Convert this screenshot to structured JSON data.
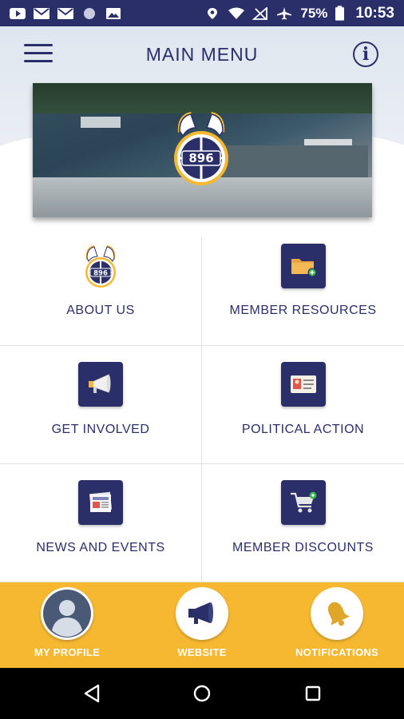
{
  "status_bar": {
    "battery": "75%",
    "time": "10:53",
    "icons": [
      "youtube-icon",
      "gmail-icon",
      "gmail-icon",
      "circle-icon",
      "image-icon",
      "location-icon",
      "wifi-icon",
      "no-signal-icon",
      "airplane-icon",
      "battery-icon"
    ]
  },
  "header": {
    "title": "MAIN MENU",
    "menu_icon": "hamburger-menu-icon",
    "info_icon": "info-icon",
    "info_glyph": "i",
    "logo_number": "896"
  },
  "menu": {
    "items": [
      {
        "label": "ABOUT US",
        "icon": "teamsters-logo-icon"
      },
      {
        "label": "MEMBER RESOURCES",
        "icon": "folder-icon"
      },
      {
        "label": "GET INVOLVED",
        "icon": "megaphone-icon"
      },
      {
        "label": "POLITICAL ACTION",
        "icon": "id-card-icon"
      },
      {
        "label": "NEWS AND EVENTS",
        "icon": "newspaper-icon"
      },
      {
        "label": "MEMBER DISCOUNTS",
        "icon": "shopping-cart-icon"
      }
    ]
  },
  "bottom_bar": {
    "items": [
      {
        "label": "MY PROFILE",
        "icon": "profile-avatar-icon"
      },
      {
        "label": "WEBSITE",
        "icon": "megaphone-icon"
      },
      {
        "label": "NOTIFICATIONS",
        "icon": "bell-icon"
      }
    ]
  },
  "colors": {
    "navy": "#2a2f6a",
    "gold": "#f6b731",
    "white": "#ffffff"
  }
}
